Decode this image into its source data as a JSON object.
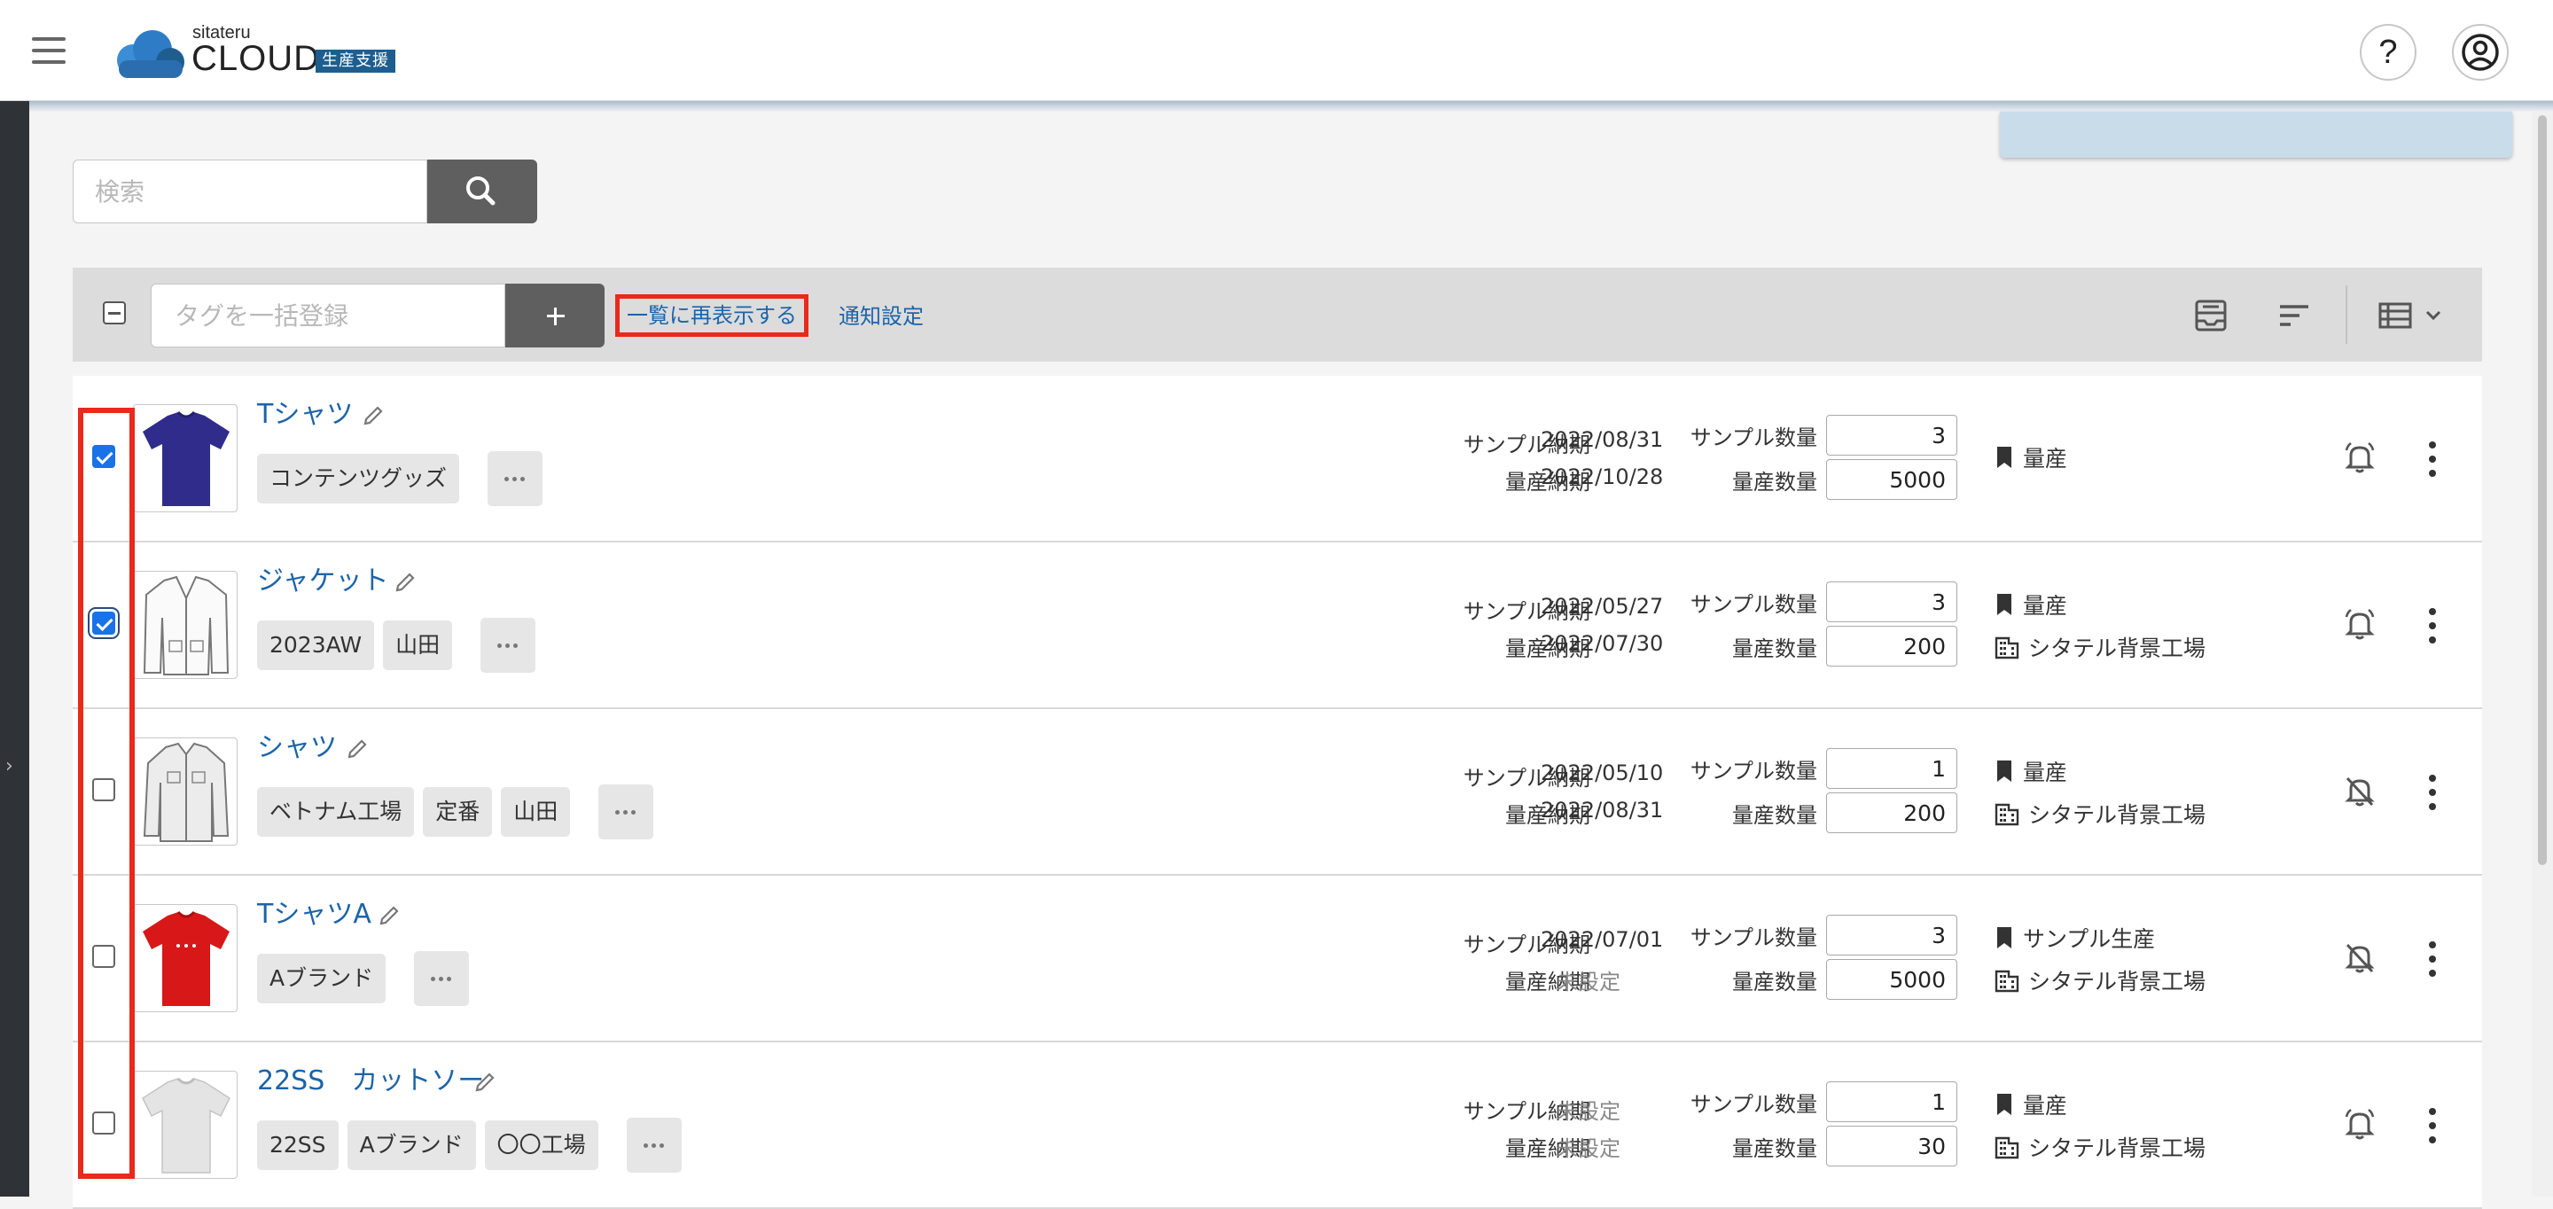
{
  "header": {
    "logo_small": "sitateru",
    "logo_main": "CLOUD",
    "logo_badge": "生産支援"
  },
  "search": {
    "placeholder": "検索"
  },
  "toolbar": {
    "tag_placeholder": "タグを一括登録",
    "redisplay_label": "一覧に再表示する",
    "notification_label": "通知設定"
  },
  "labels": {
    "sample_due": "サンプル納期",
    "mass_due": "量産納期",
    "sample_qty": "サンプル数量",
    "mass_qty": "量産数量"
  },
  "items": [
    {
      "name": "Tシャツ",
      "tags": [
        "コンテンツグッズ"
      ],
      "sample_due": "2022/08/31",
      "mass_due": "2022/10/28",
      "sample_qty": "3",
      "mass_qty": "5000",
      "phase": "量産",
      "factory": "",
      "checked": true,
      "notify": true
    },
    {
      "name": "ジャケット",
      "tags": [
        "2023AW",
        "山田"
      ],
      "sample_due": "2022/05/27",
      "mass_due": "2022/07/30",
      "sample_qty": "3",
      "mass_qty": "200",
      "phase": "量産",
      "factory": "シタテル背景工場",
      "checked": true,
      "notify": true
    },
    {
      "name": "シャツ",
      "tags": [
        "ベトナム工場",
        "定番",
        "山田"
      ],
      "sample_due": "2022/05/10",
      "mass_due": "2022/08/31",
      "sample_qty": "1",
      "mass_qty": "200",
      "phase": "量産",
      "factory": "シタテル背景工場",
      "checked": false,
      "notify": false
    },
    {
      "name": "TシャツA",
      "tags": [
        "Aブランド"
      ],
      "sample_due": "2022/07/01",
      "mass_due": "未設定",
      "sample_qty": "3",
      "mass_qty": "5000",
      "phase": "サンプル生産",
      "factory": "シタテル背景工場",
      "checked": false,
      "notify": false
    },
    {
      "name": "22SS　カットソー",
      "tags": [
        "22SS",
        "Aブランド",
        "〇〇工場"
      ],
      "sample_due": "未設定",
      "mass_due": "未設定",
      "sample_qty": "1",
      "mass_qty": "30",
      "phase": "量産",
      "factory": "シタテル背景工場",
      "checked": false,
      "notify": true
    }
  ],
  "icons": {
    "menu": "hamburger-menu-icon",
    "search": "search-icon",
    "help": "help-icon",
    "account": "account-icon",
    "archive": "archive-tray-icon",
    "sort": "sort-icon",
    "view": "list-view-icon",
    "edit": "pencil-icon",
    "phase": "bookmark-icon",
    "factory": "building-icon",
    "bell_on": "bell-ringing-icon",
    "bell_off": "bell-off-icon",
    "more": "more-vertical-icon"
  },
  "colors": {
    "link": "#1c64a8",
    "highlight": "#e8291c",
    "checkbox_checked": "#1a72e8",
    "logo_badge": "#1e5e8f",
    "sidebar": "#2f3337",
    "toolbar": "#dcdcdc"
  }
}
